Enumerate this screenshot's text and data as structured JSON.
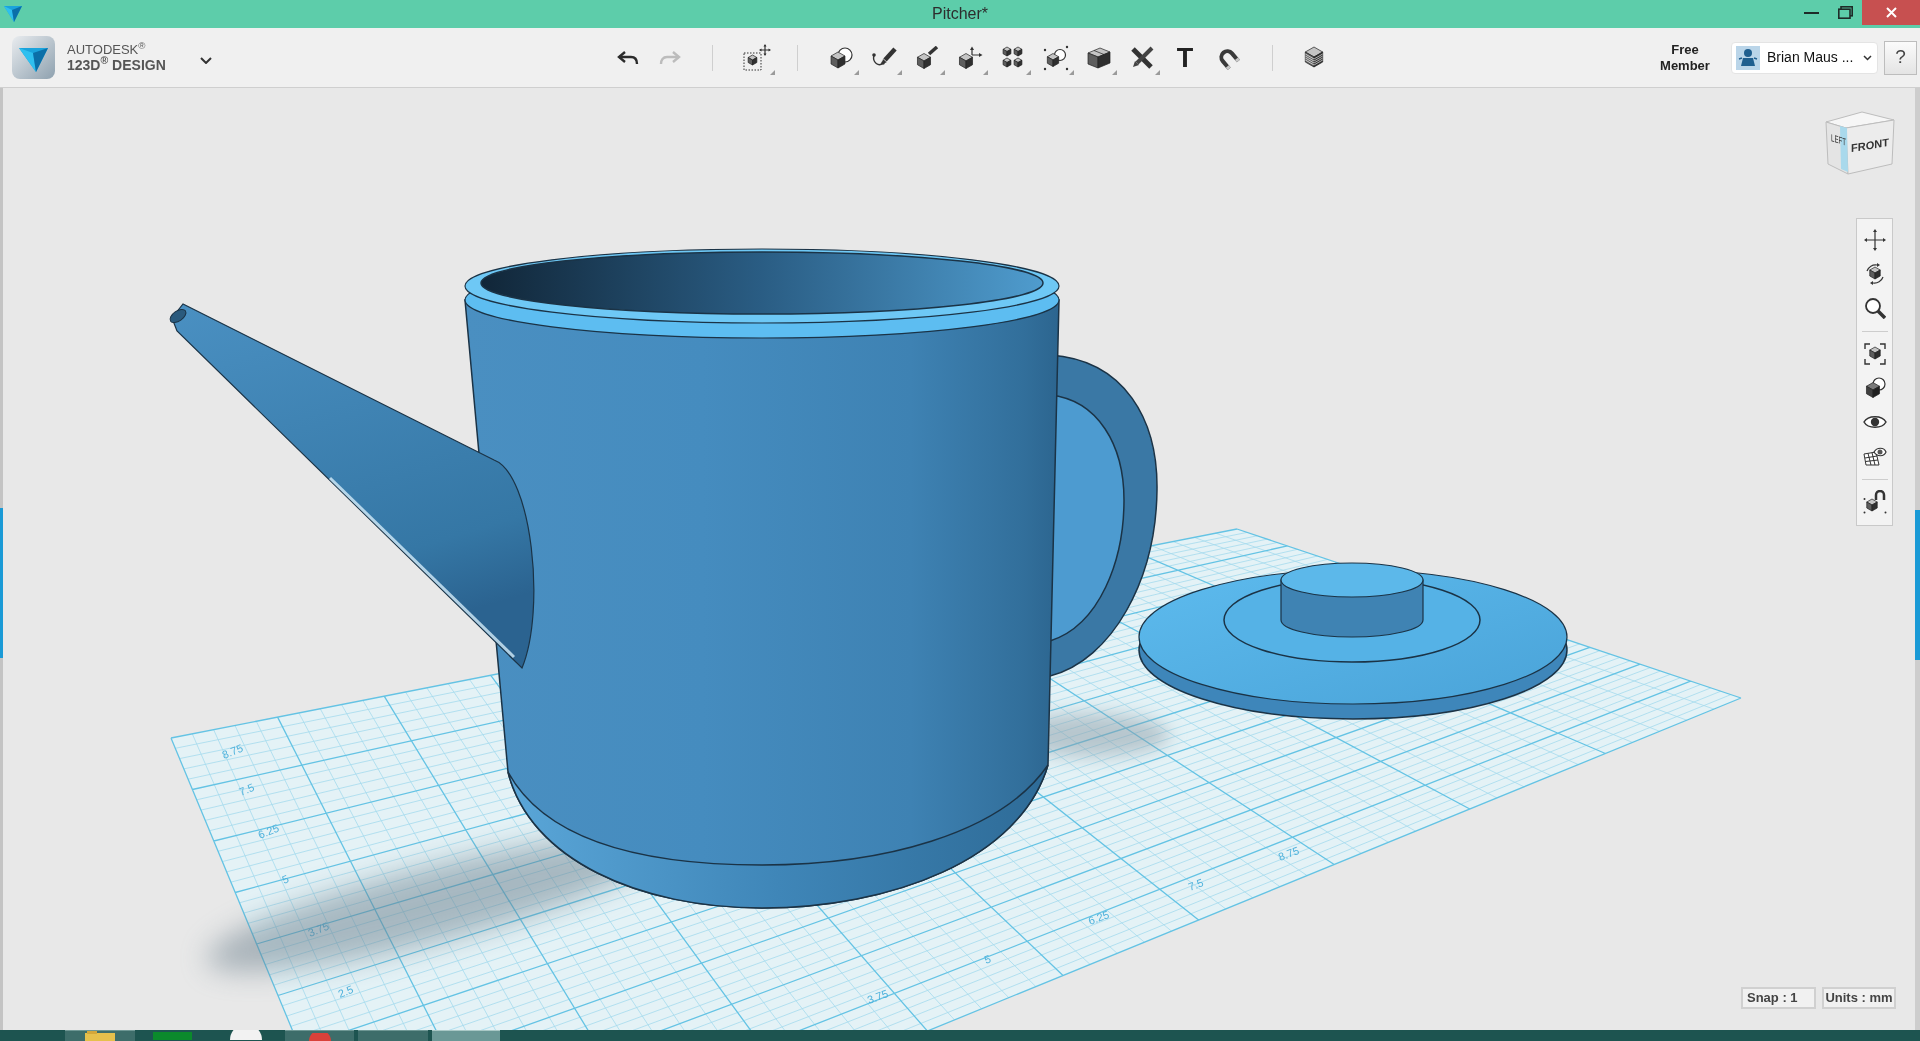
{
  "window": {
    "title": "Pitcher*"
  },
  "app": {
    "brand": "AUTODESK$^{®}$",
    "product": "123D$^{®}$ DESIGN"
  },
  "toolbar": {
    "undo": {
      "disabled": false
    },
    "redo": {
      "disabled": true
    },
    "text_tool": "T"
  },
  "account": {
    "plan": "Free Member",
    "user_name": "Brian Maus ...",
    "help": "?"
  },
  "view_cube": {
    "faces": [
      "LEFT",
      "FRONT"
    ]
  },
  "grid_labels": {
    "side": [
      "8.75",
      "7.5",
      "6.25",
      "5",
      "3.75",
      "2.5"
    ],
    "front": [
      "3.75",
      "5",
      "6.25",
      "7.5",
      "8.75"
    ]
  },
  "status": {
    "snap": "Snap : 1",
    "units": "Units : mm"
  }
}
